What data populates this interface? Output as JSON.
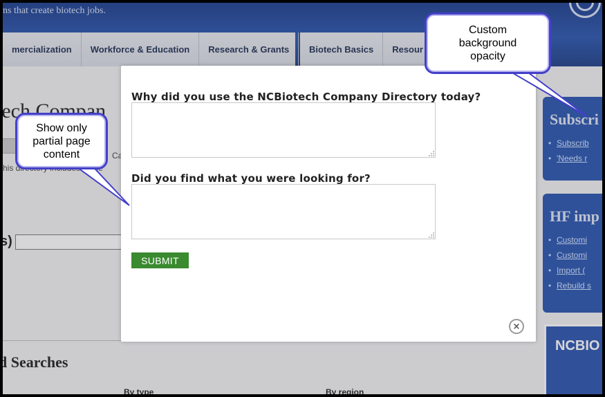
{
  "header": {
    "tagline": "ns that create biotech jobs."
  },
  "nav": {
    "left_tabs": [
      "mercialization",
      "Workforce & Education",
      "Research & Grants"
    ],
    "right_tabs": [
      "Biotech Basics",
      "Resour"
    ]
  },
  "background_page": {
    "title": "tech Compan",
    "text_line1": "Ca",
    "text_line2": "his directory includes those",
    "paren": "s)",
    "section_heading": "d Searches",
    "by_type": "By type",
    "by_region": "By region"
  },
  "sidebar": {
    "subscribe": {
      "heading": "Subscri",
      "links": [
        "Subscrib",
        "'Needs r"
      ]
    },
    "hf": {
      "heading": "HF imp",
      "links": [
        "Customi",
        "Customi",
        "Import (",
        "Rebuild s"
      ]
    },
    "logo_text": "NCBIO"
  },
  "modal": {
    "question1": "Why did you use the NCBiotech Company Directory today?",
    "answer1": "",
    "question2": "Did you find what you were looking for?",
    "answer2": "",
    "submit_label": "SUBMIT",
    "close_symbol": "×"
  },
  "callouts": {
    "background_opacity": "Custom background opacity",
    "partial_content": "Show only partial page content"
  },
  "colors": {
    "header_blue": "#2b56ad",
    "submit_green": "#3a8a2f",
    "callout_border": "#4440c9"
  }
}
